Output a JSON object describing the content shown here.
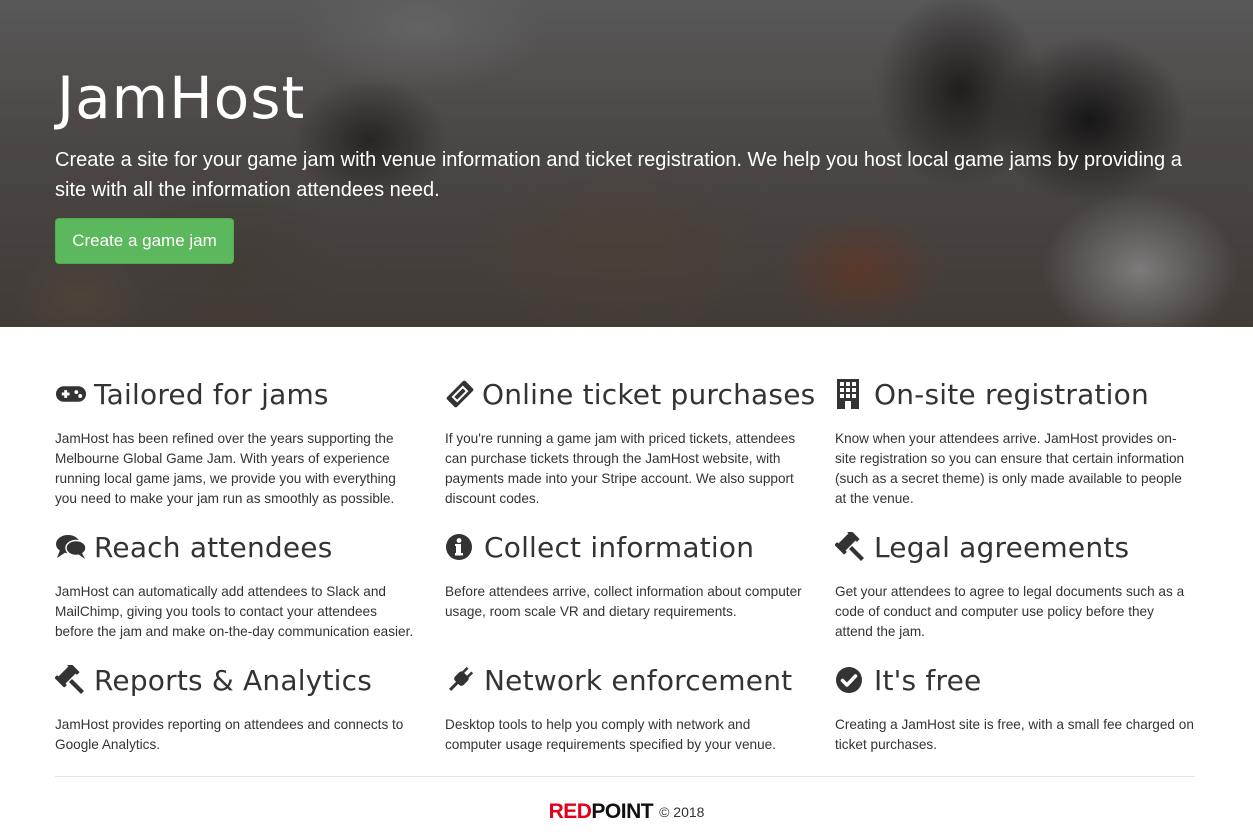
{
  "hero": {
    "title": "JamHost",
    "description": "Create a site for your game jam with venue information and ticket registration. We help you host local game jams by providing a site with all the information attendees need.",
    "cta_label": "Create a game jam"
  },
  "features": [
    {
      "icon": "gamepad-icon",
      "title": "Tailored for jams",
      "text": "JamHost has been refined over the years supporting the Melbourne Global Game Jam. With years of experience running local game jams, we provide you with everything you need to make your jam run as smoothly as possible."
    },
    {
      "icon": "ticket-icon",
      "title": "Online ticket purchases",
      "text": "If you're running a game jam with priced tickets, attendees can purchase tickets through the JamHost website, with payments made into your Stripe account. We also support discount codes."
    },
    {
      "icon": "building-icon",
      "title": "On-site registration",
      "text": "Know when your attendees arrive. JamHost provides on-site registration so you can ensure that certain information (such as a secret theme) is only made available to people at the venue."
    },
    {
      "icon": "comments-icon",
      "title": "Reach attendees",
      "text": "JamHost can automatically add attendees to Slack and MailChimp, giving you tools to contact your attendees before the jam and make on-the-day communication easier."
    },
    {
      "icon": "info-circle-icon",
      "title": "Collect information",
      "text": "Before attendees arrive, collect information about computer usage, room scale VR and dietary requirements."
    },
    {
      "icon": "gavel-icon",
      "title": "Legal agreements",
      "text": "Get your attendees to agree to legal documents such as a code of conduct and computer use policy before they attend the jam."
    },
    {
      "icon": "gavel-icon",
      "title": "Reports & Analytics",
      "text": "JamHost provides reporting on attendees and connects to Google Analytics."
    },
    {
      "icon": "plug-icon",
      "title": "Network enforcement",
      "text": "Desktop tools to help you comply with network and computer usage requirements specified by your venue."
    },
    {
      "icon": "check-circle-icon",
      "title": "It's free",
      "text": "Creating a JamHost site is free, with a small fee charged on ticket purchases."
    }
  ],
  "footer": {
    "brand_red": "RED",
    "brand_black": "POINT",
    "copyright": "© 2018"
  },
  "colors": {
    "cta": "#5cb85c",
    "brand_red": "#e2001a"
  }
}
